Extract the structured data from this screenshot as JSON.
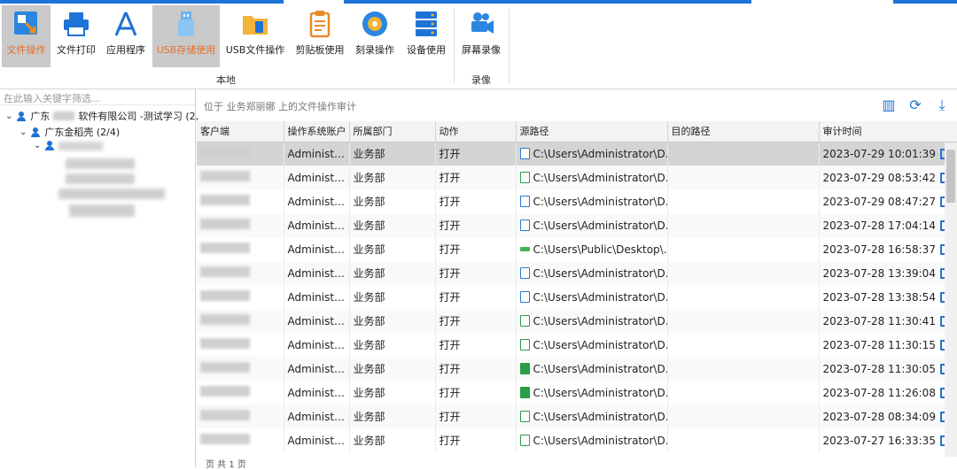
{
  "ribbon": {
    "buttons": [
      {
        "label": "文件操作",
        "icon": "file-operation-icon",
        "active": true
      },
      {
        "label": "文件打印",
        "icon": "printer-icon"
      },
      {
        "label": "应用程序",
        "icon": "app-store-icon"
      },
      {
        "label": "USB存储使用",
        "icon": "usb-icon",
        "active": true
      },
      {
        "label": "USB文件操作",
        "icon": "usb-folder-icon"
      },
      {
        "label": "剪贴板使用",
        "icon": "clipboard-icon"
      },
      {
        "label": "刻录操作",
        "icon": "disc-icon"
      },
      {
        "label": "设备使用",
        "icon": "server-icon"
      },
      {
        "label": "屏幕录像",
        "icon": "video-camera-icon"
      }
    ],
    "group_local": "本地",
    "group_record": "录像"
  },
  "tree": {
    "filter_placeholder": "在此输入关键字筛选...",
    "root_prefix": "广东",
    "root_suffix": "软件有限公司 -测试学习 (2,",
    "child_label": "广东金稻壳 (2/4)"
  },
  "main": {
    "info_text": "位于 业务郑丽娜 上的文件操作审计",
    "columns": [
      "客户端",
      "操作系统账户",
      "所属部门",
      "动作",
      "源路径",
      "目的路径",
      "审计时间"
    ],
    "rows": [
      {
        "account": "Administra...",
        "dept": "业务部",
        "action": "打开",
        "icon": "word",
        "path": "C:\\Users\\Administrator\\D...",
        "time": "2023-07-29 10:01:39",
        "selected": true
      },
      {
        "account": "Administra...",
        "dept": "业务部",
        "action": "打开",
        "icon": "green",
        "path": "C:\\Users\\Administrator\\D...",
        "time": "2023-07-29 08:53:42"
      },
      {
        "account": "Administra...",
        "dept": "业务部",
        "action": "打开",
        "icon": "word",
        "path": "C:\\Users\\Administrator\\D...",
        "time": "2023-07-29 08:47:27"
      },
      {
        "account": "Administra...",
        "dept": "业务部",
        "action": "打开",
        "icon": "word",
        "path": "C:\\Users\\Administrator\\D...",
        "time": "2023-07-28 17:04:14"
      },
      {
        "account": "Administra...",
        "dept": "业务部",
        "action": "打开",
        "icon": "bar",
        "path": "C:\\Users\\Public\\Desktop\\...",
        "time": "2023-07-28 16:58:37"
      },
      {
        "account": "Administra...",
        "dept": "业务部",
        "action": "打开",
        "icon": "word",
        "path": "C:\\Users\\Administrator\\D...",
        "time": "2023-07-28 13:39:04"
      },
      {
        "account": "Administra...",
        "dept": "业务部",
        "action": "打开",
        "icon": "word",
        "path": "C:\\Users\\Administrator\\D...",
        "time": "2023-07-28 13:38:54"
      },
      {
        "account": "Administra...",
        "dept": "业务部",
        "action": "打开",
        "icon": "green",
        "path": "C:\\Users\\Administrator\\D...",
        "time": "2023-07-28 11:30:41"
      },
      {
        "account": "Administra...",
        "dept": "业务部",
        "action": "打开",
        "icon": "green",
        "path": "C:\\Users\\Administrator\\D...",
        "time": "2023-07-28 11:30:15"
      },
      {
        "account": "Administra...",
        "dept": "业务部",
        "action": "打开",
        "icon": "greenfill",
        "path": "C:\\Users\\Administrator\\D...",
        "time": "2023-07-28 11:30:05"
      },
      {
        "account": "Administra...",
        "dept": "业务部",
        "action": "打开",
        "icon": "greenfill",
        "path": "C:\\Users\\Administrator\\D...",
        "time": "2023-07-28 11:26:08"
      },
      {
        "account": "Administra...",
        "dept": "业务部",
        "action": "打开",
        "icon": "green",
        "path": "C:\\Users\\Administrator\\D...",
        "time": "2023-07-28 08:34:09"
      },
      {
        "account": "Administra...",
        "dept": "业务部",
        "action": "打开",
        "icon": "green",
        "path": "C:\\Users\\Administrator\\D...",
        "time": "2023-07-27 16:33:35"
      }
    ]
  },
  "pager": {
    "text": "页  共 1 页"
  },
  "colors": {
    "accent": "#1e73d6",
    "active_text": "#e3712a",
    "active_bg": "#c9c9c9"
  }
}
